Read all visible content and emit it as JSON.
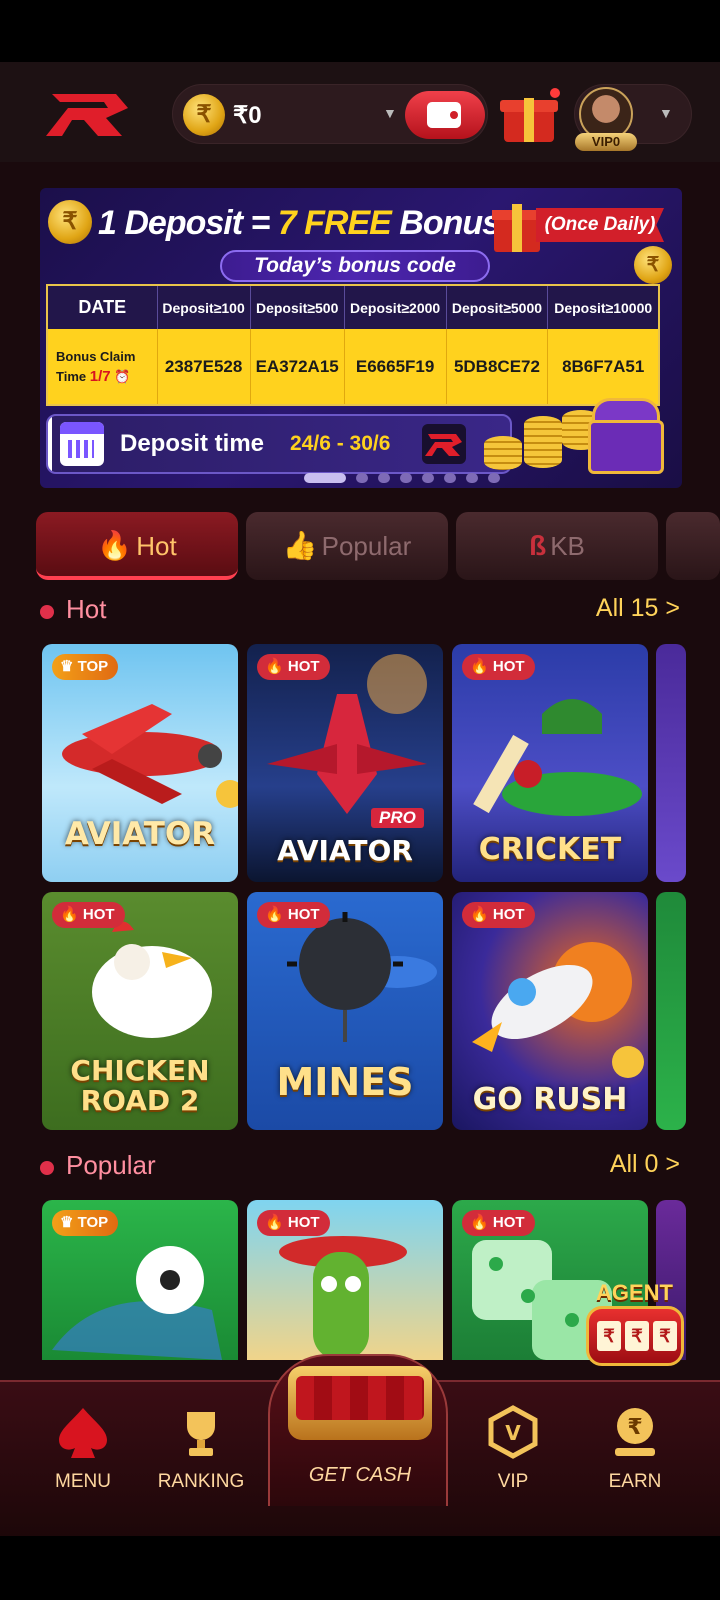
{
  "header": {
    "currency_symbol": "₹",
    "balance": "₹0",
    "vip_level": "VIP0"
  },
  "banner": {
    "title_prefix": "1 Deposit = ",
    "title_highlight": "7 FREE",
    "title_suffix": " Bonuses!",
    "once_daily": "(Once Daily)",
    "bonus_code_label": "Today’s bonus code",
    "table": {
      "headers": [
        "DATE",
        "Deposit≥100",
        "Deposit≥500",
        "Deposit≥2000",
        "Deposit≥5000",
        "Deposit≥10000"
      ],
      "claim_label": "Bonus Claim Time",
      "claim_count": "1/7",
      "codes": [
        "2387E528",
        "EA372A15",
        "E6665F19",
        "5DB8CE72",
        "8B6F7A51"
      ]
    },
    "deposit_time_label": "Deposit time",
    "deposit_time_range": "24/6 - 30/6",
    "active_slide": 1,
    "slide_count": 8
  },
  "tabs": [
    {
      "label": "Hot",
      "icon": "flame-icon",
      "active": true
    },
    {
      "label": "Popular",
      "icon": "thumbs-up-icon",
      "active": false
    },
    {
      "label": "KB",
      "icon": "kb-logo-icon",
      "active": false
    }
  ],
  "sections": {
    "hot": {
      "title": "Hot",
      "all_label": "All 15 >"
    },
    "popular": {
      "title": "Popular",
      "all_label": "All 0 >"
    }
  },
  "hot_games": [
    {
      "name": "AVIATOR",
      "badge": "TOP"
    },
    {
      "name": "AVIATOR",
      "sub": "PRO",
      "badge": "HOT"
    },
    {
      "name": "CRICKET",
      "badge": "HOT"
    },
    {
      "name": "CHICKEN ROAD 2",
      "badge": "HOT"
    },
    {
      "name": "MINES",
      "badge": "HOT"
    },
    {
      "name": "GO RUSH",
      "badge": "HOT"
    }
  ],
  "popular_games": [
    {
      "badge": "TOP"
    },
    {
      "badge": "HOT"
    },
    {
      "badge": "HOT"
    }
  ],
  "agent": {
    "label": "AGENT",
    "symbol": "₹"
  },
  "nav": {
    "menu": "MENU",
    "ranking": "RANKING",
    "get_cash": "GET CASH",
    "vip": "VIP",
    "earn": "EARN"
  },
  "colors": {
    "accent_red": "#d22c3a",
    "gold": "#ffd21e",
    "background": "#1a0a0d"
  }
}
